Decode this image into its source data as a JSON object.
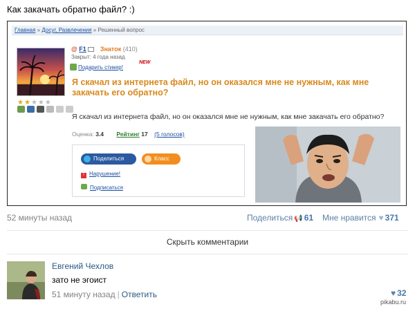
{
  "post": {
    "title": "Как закачать обратно файл? :)"
  },
  "embed": {
    "breadcrumb": {
      "home": "Главная",
      "sep": " » ",
      "category": "Досуг, Развлечения",
      "current": "Решенный вопрос"
    },
    "user": {
      "at": "@",
      "nick": "F1",
      "rank": "Знаток",
      "score": "(410)",
      "closed": "Закрыт: 4 года назад",
      "sticker": "Подарить стикер!",
      "new_badge": "NEW"
    },
    "question": "Я скачал из интернета файл, но он оказался мне не нужным, как мне закачать его обратно?",
    "body": "Я скачал из интернета файл, но он оказался мне не нужным, как мне закачать его обратно?",
    "rating": {
      "score_label": "Оценка:",
      "score": "3.4",
      "rating_label": "Рейтинг",
      "rating": "17",
      "votes": "(5 голосов)"
    },
    "share_box": {
      "share": "Поделиться",
      "class": "Класс",
      "violation": "Нарушение!",
      "subscribe": "Подписаться"
    }
  },
  "footer": {
    "time": "52 минуты назад",
    "share_label": "Поделиться",
    "share_count": "61",
    "like_label": "Мне нравится",
    "like_count": "371"
  },
  "comments": {
    "hide_label": "Скрыть комментарии",
    "items": [
      {
        "author": "Евгений Чехлов",
        "text": "зато не эгоист",
        "time": "51 минуту назад",
        "reply": "Ответить",
        "likes": "32"
      }
    ]
  },
  "watermark": "pikabu.ru",
  "colors": {
    "link": "#2a5885",
    "question": "#d8881c",
    "share_button": "#2b5aa0",
    "class_button": "#f28e1f"
  }
}
